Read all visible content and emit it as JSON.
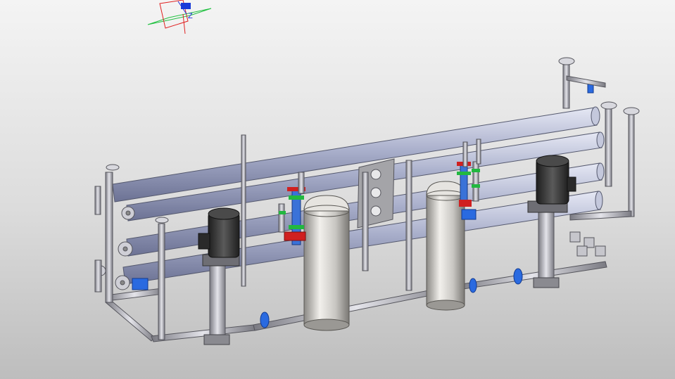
{
  "viewport": {
    "triad": {
      "z_label": "Z",
      "colors": {
        "x": "#e02020",
        "y": "#20c040",
        "z": "#2030e0",
        "selected": "#1a3bd8"
      }
    },
    "model": {
      "colors": {
        "membrane": "#a7acc8",
        "membrane_dark": "#6f7596",
        "pipe": "#b8b8c0",
        "pipe_dark": "#6a6a72",
        "motor": "#3a3a3a",
        "tank": "#d8d6d2",
        "valve_blue": "#2a6ae0",
        "valve_red": "#d02020",
        "flange_green": "#22b840",
        "plate": "#9a9a9e"
      }
    }
  }
}
